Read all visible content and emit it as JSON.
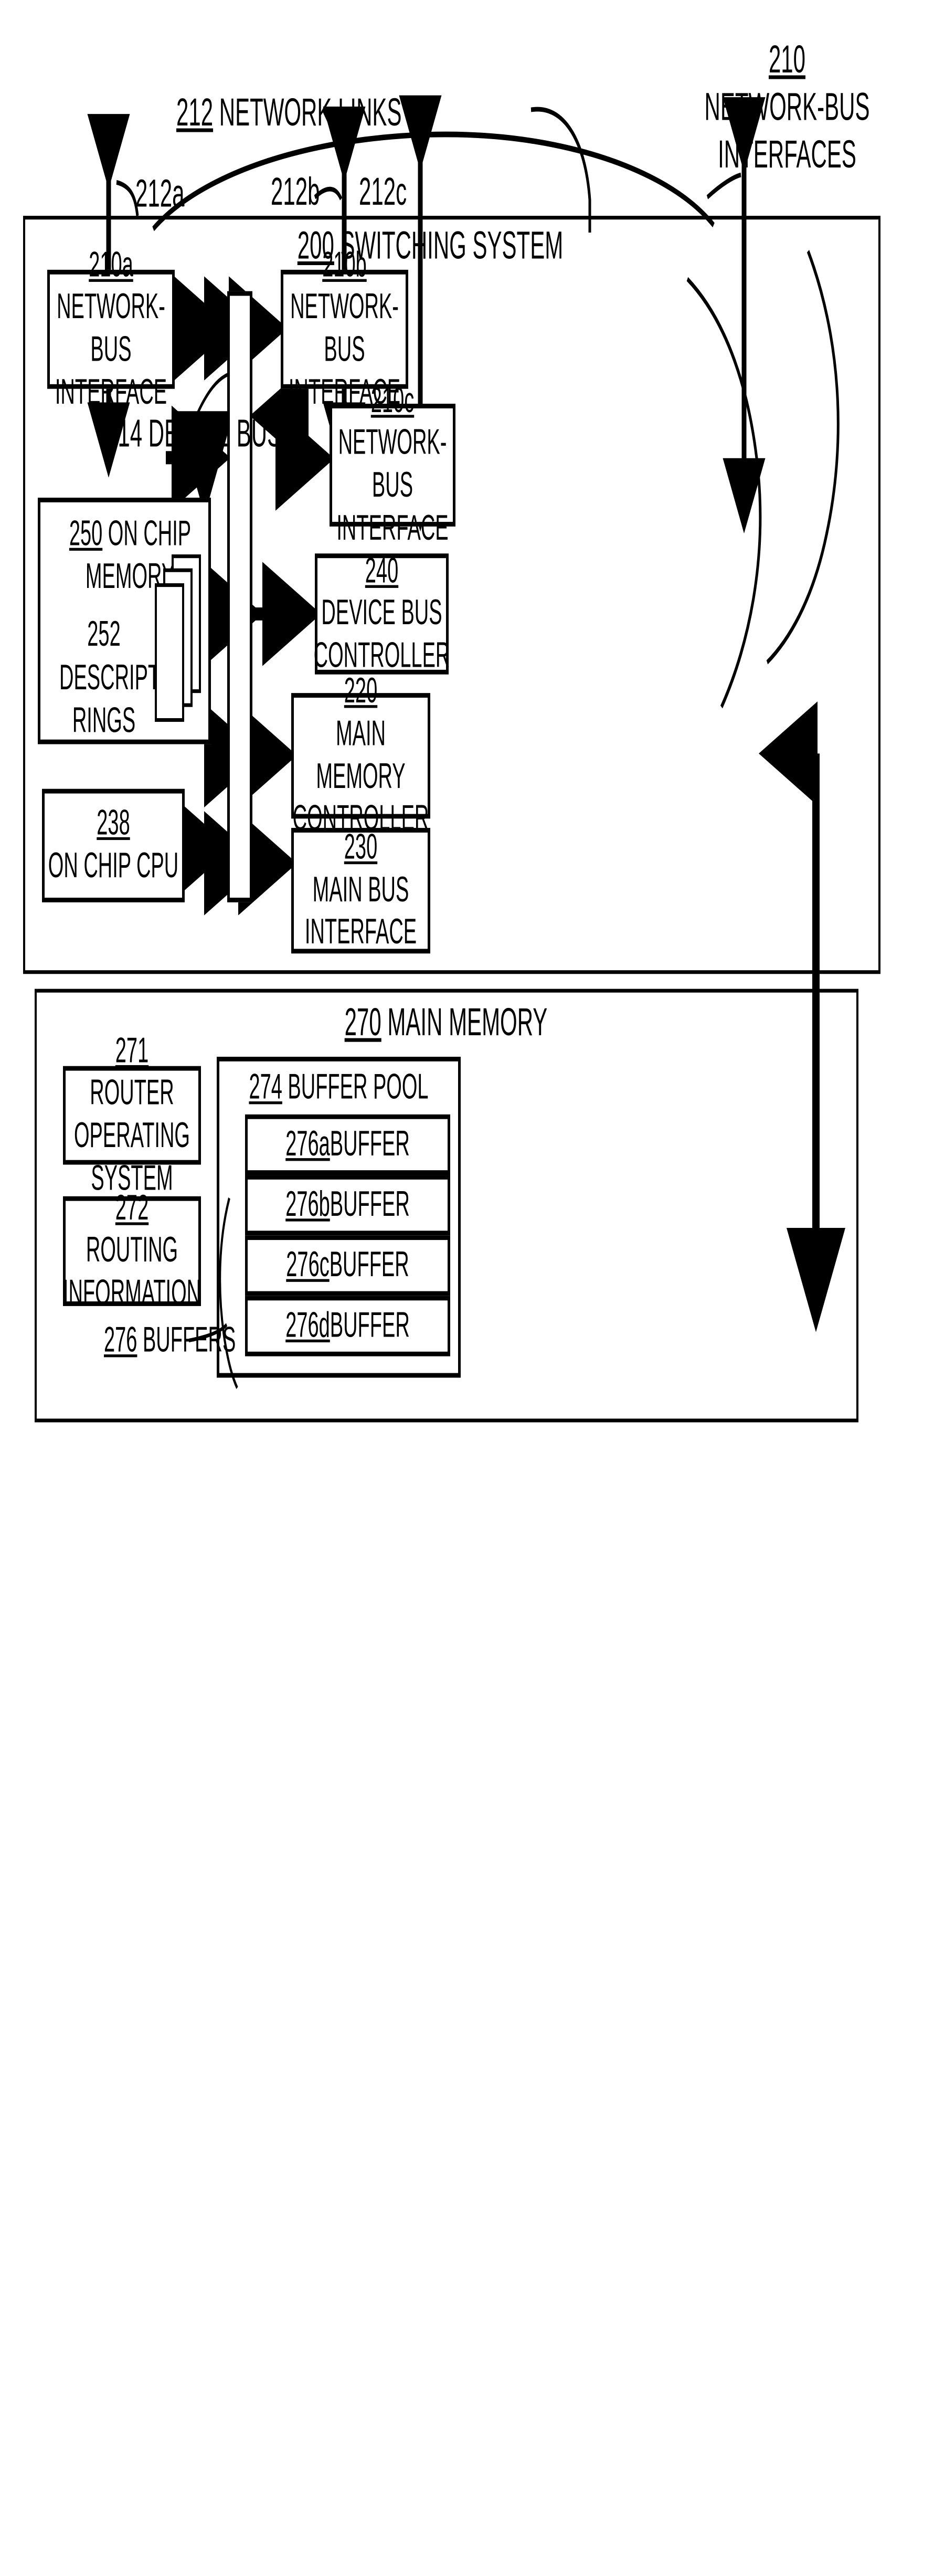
{
  "figure": {
    "top_labels": {
      "network_links": {
        "num": "212",
        "text": " NETWORK LINKS"
      },
      "network_bus_interfaces": {
        "num": "210",
        "line1": "NETWORK-BUS",
        "line2": "INTERFACES"
      },
      "link_a": "212a",
      "link_b": "212b",
      "link_c": "212c"
    },
    "switching_system": {
      "num": "200",
      "text": " SWITCHING SYSTEM",
      "device_bus_label": {
        "num": "214",
        "text": " DEVICE BUS"
      },
      "blocks": [
        {
          "id": "nbi-a",
          "num": "210a",
          "line1": "NETWORK-BUS",
          "line2": "INTERFACE"
        },
        {
          "id": "nbi-b",
          "num": "210b",
          "line1": "NETWORK-BUS",
          "line2": "INTERFACE"
        },
        {
          "id": "nbi-c",
          "num": "210c",
          "line1": "NETWORK-BUS",
          "line2": "INTERFACE"
        },
        {
          "id": "on-chip-memory",
          "num": "250",
          "title": " ON CHIP MEMORY",
          "inner": {
            "num": "252",
            "line1": "DESCRIPTOR",
            "line2": "RINGS"
          }
        },
        {
          "id": "device-bus-controller",
          "num": "240",
          "line1": "DEVICE BUS",
          "line2": "CONTROLLER"
        },
        {
          "id": "main-memory-controller",
          "num": "220",
          "line1": "MAIN MEMORY",
          "line2": "CONTROLLER"
        },
        {
          "id": "on-chip-cpu",
          "num": "238",
          "line1": "ON CHIP CPU",
          "line2": ""
        },
        {
          "id": "main-bus-interface",
          "num": "230",
          "line1": "MAIN BUS",
          "line2": "INTERFACE"
        }
      ]
    },
    "main_memory": {
      "num": "270",
      "text": " MAIN MEMORY",
      "router_os": {
        "num": "271",
        "line1": "ROUTER OPERATING",
        "line2": "SYSTEM"
      },
      "routing_info": {
        "num": "272",
        "line1": "ROUTING",
        "line2": "INFORMATION"
      },
      "buffers_label": {
        "num": "276",
        "text": " BUFFERS"
      },
      "buffer_pool": {
        "num": "274",
        "text": " BUFFER POOL",
        "buffers": [
          {
            "num": "276a",
            "text": " BUFFER"
          },
          {
            "num": "276b",
            "text": " BUFFER"
          },
          {
            "num": "276c",
            "text": "BUFFER"
          },
          {
            "num": "276d",
            "text": " BUFFER"
          }
        ]
      }
    },
    "colors": {
      "ink": "#000000",
      "paper": "#ffffff"
    }
  }
}
